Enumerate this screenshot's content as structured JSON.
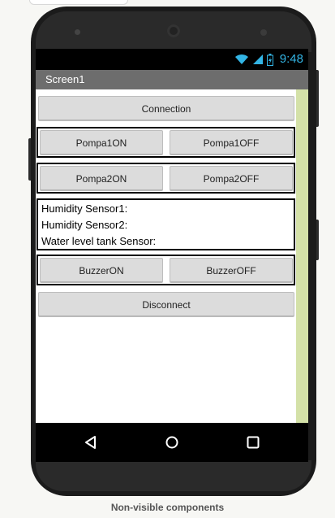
{
  "status_bar": {
    "time": "9:48",
    "icons": [
      "wifi-icon",
      "signal-icon",
      "battery-icon"
    ],
    "accent_color": "#33b5e5"
  },
  "title_bar": {
    "title": "Screen1"
  },
  "buttons": {
    "connection": "Connection",
    "pompa1_on": "Pompa1ON",
    "pompa1_off": "Pompa1OFF",
    "pompa2_on": "Pompa2ON",
    "pompa2_off": "Pompa2OFF",
    "buzzer_on": "BuzzerON",
    "buzzer_off": "BuzzerOFF",
    "disconnect": "Disconnect"
  },
  "sensors": {
    "humidity1": "Humidity Sensor1:",
    "humidity2": "Humidity Sensor2:",
    "water_level": "Water level tank Sensor:"
  },
  "nav_bar": {
    "icons": [
      "back-icon",
      "home-icon",
      "recents-icon"
    ]
  },
  "footer": {
    "label": "Non-visible components"
  },
  "colors": {
    "scrollbar": "#d4e1a8",
    "title_bar": "#6d6d6d"
  }
}
